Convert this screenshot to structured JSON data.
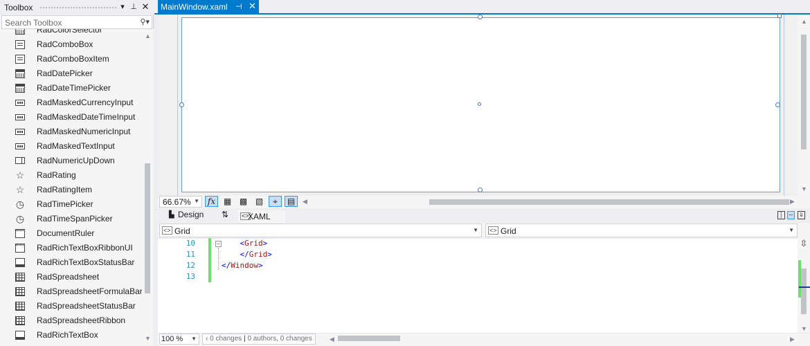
{
  "toolbox": {
    "title": "Toolbox",
    "search_placeholder": "Search Toolbox",
    "items": [
      {
        "label": "RadColorSelector",
        "icon": "color-selector-icon"
      },
      {
        "label": "RadComboBox",
        "icon": "combobox-icon"
      },
      {
        "label": "RadComboBoxItem",
        "icon": "combobox-item-icon"
      },
      {
        "label": "RadDatePicker",
        "icon": "calendar-icon"
      },
      {
        "label": "RadDateTimePicker",
        "icon": "calendar-time-icon"
      },
      {
        "label": "RadMaskedCurrencyInput",
        "icon": "masked-input-icon"
      },
      {
        "label": "RadMaskedDateTimeInput",
        "icon": "masked-input-icon"
      },
      {
        "label": "RadMaskedNumericInput",
        "icon": "masked-input-icon"
      },
      {
        "label": "RadMaskedTextInput",
        "icon": "masked-input-icon"
      },
      {
        "label": "RadNumericUpDown",
        "icon": "numeric-updown-icon"
      },
      {
        "label": "RadRating",
        "icon": "star-icon"
      },
      {
        "label": "RadRatingItem",
        "icon": "star-icon"
      },
      {
        "label": "RadTimePicker",
        "icon": "clock-icon"
      },
      {
        "label": "RadTimeSpanPicker",
        "icon": "clock-icon"
      },
      {
        "label": "DocumentRuler",
        "icon": "ruler-icon"
      },
      {
        "label": "RadRichTextBoxRibbonUI",
        "icon": "ribbon-icon"
      },
      {
        "label": "RadRichTextBoxStatusBar",
        "icon": "statusbar-icon"
      },
      {
        "label": "RadSpreadsheet",
        "icon": "spreadsheet-icon"
      },
      {
        "label": "RadSpreadsheetFormulaBar",
        "icon": "spreadsheet-icon"
      },
      {
        "label": "RadSpreadsheetStatusBar",
        "icon": "spreadsheet-icon"
      },
      {
        "label": "RadSpreadsheetRibbon",
        "icon": "spreadsheet-icon"
      },
      {
        "label": "RadRichTextBox",
        "icon": "richtextbox-icon"
      }
    ]
  },
  "document": {
    "tab_label": "MainWindow.xaml",
    "designer_zoom": "66.67%",
    "design_tab": "Design",
    "swap_glyph": "⇅",
    "xaml_tab": "XAML",
    "nav_left": "Grid",
    "nav_right": "Grid",
    "code_lines": [
      {
        "num": "10",
        "indent": "    ",
        "open": "<",
        "tag": "Grid",
        "close": ">"
      },
      {
        "num": "11",
        "indent": "    ",
        "open": "</",
        "tag": "Grid",
        "close": ">"
      },
      {
        "num": "12",
        "indent": "",
        "open": "</",
        "tag": "Window",
        "close": ">"
      },
      {
        "num": "13",
        "indent": "",
        "open": "",
        "tag": "",
        "close": ""
      }
    ],
    "editor_zoom": "100 %",
    "changes": "0 changes",
    "authors": "0 authors, 0 changes"
  },
  "colors": {
    "accent": "#007acc",
    "change_bar": "#6be06b"
  }
}
